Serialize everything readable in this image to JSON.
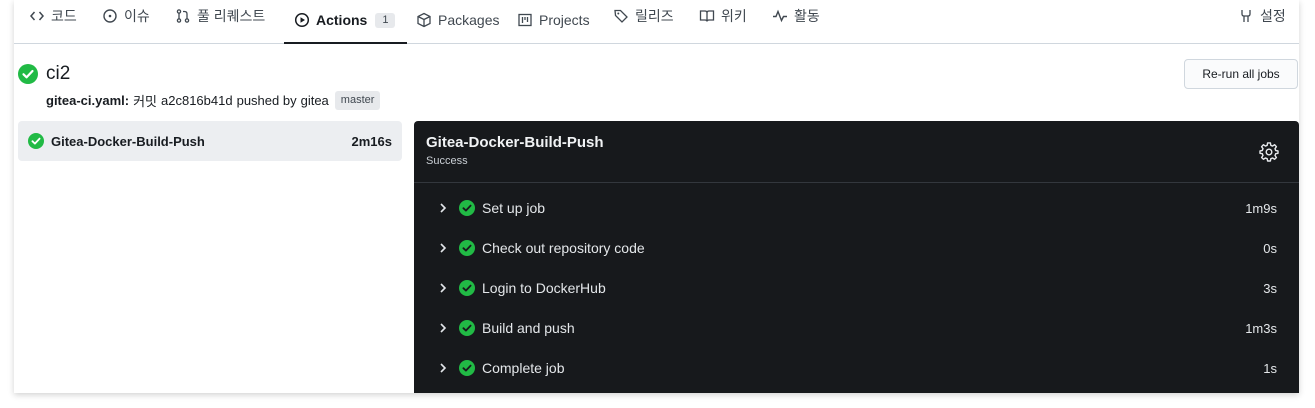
{
  "tabs": [
    {
      "label": "코드",
      "icon": "code-icon"
    },
    {
      "label": "이슈",
      "icon": "issue-icon"
    },
    {
      "label": "풀 리퀘스트",
      "icon": "pull-request-icon"
    },
    {
      "label": "Actions",
      "icon": "play-icon",
      "count": "1",
      "active": true
    },
    {
      "label": "Packages",
      "icon": "package-icon"
    },
    {
      "label": "Projects",
      "icon": "project-icon"
    },
    {
      "label": "릴리즈",
      "icon": "tag-icon"
    },
    {
      "label": "위키",
      "icon": "book-icon"
    },
    {
      "label": "활동",
      "icon": "pulse-icon"
    },
    {
      "label": "설정",
      "icon": "tools-icon"
    }
  ],
  "run": {
    "title": "ci2",
    "status": "success",
    "workflow": "gitea-ci.yaml:",
    "commit_label": "커밋",
    "commit_sha": "a2c816b41d",
    "pushed_by": "pushed by",
    "user": "gitea",
    "branch": "master"
  },
  "rerun_label": "Re-run all jobs",
  "jobs": [
    {
      "name": "Gitea-Docker-Build-Push",
      "duration": "2m16s",
      "status": "success"
    }
  ],
  "job_panel": {
    "title": "Gitea-Docker-Build-Push",
    "status_text": "Success",
    "steps": [
      {
        "name": "Set up job",
        "duration": "1m9s"
      },
      {
        "name": "Check out repository code",
        "duration": "0s"
      },
      {
        "name": "Login to DockerHub",
        "duration": "3s"
      },
      {
        "name": "Build and push",
        "duration": "1m3s"
      },
      {
        "name": "Complete job",
        "duration": "1s"
      }
    ]
  },
  "colors": {
    "success": "#21ba45",
    "panel_bg": "#17191c",
    "active_tab_border": "#181c21"
  }
}
